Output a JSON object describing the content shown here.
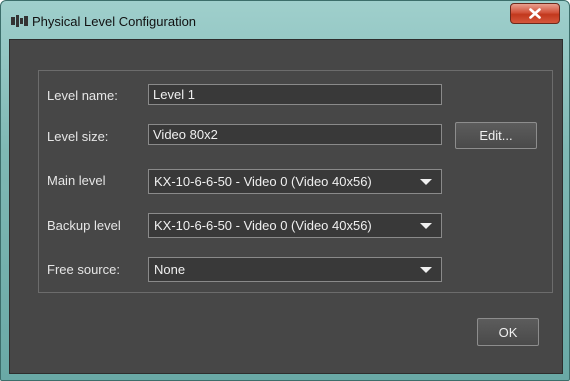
{
  "window": {
    "title": "Physical Level Configuration",
    "icon": "app-logo-icon",
    "close_icon": "close-icon"
  },
  "form": {
    "level_name": {
      "label": "Level name:",
      "value": "Level 1"
    },
    "level_size": {
      "label": "Level size:",
      "value": "Video 80x2",
      "edit_label": "Edit..."
    },
    "main_level": {
      "label": "Main level",
      "value": "KX-10-6-6-50 - Video 0 (Video 40x56)"
    },
    "backup_level": {
      "label": "Backup level",
      "value": "KX-10-6-6-50 - Video 0 (Video 40x56)"
    },
    "free_source": {
      "label": "Free source:",
      "value": "None"
    }
  },
  "footer": {
    "ok_label": "OK"
  },
  "colors": {
    "titlebar": "#8cc3c0",
    "client_bg": "#474747",
    "field_bg": "#393939",
    "close_button": "#c94a30"
  }
}
